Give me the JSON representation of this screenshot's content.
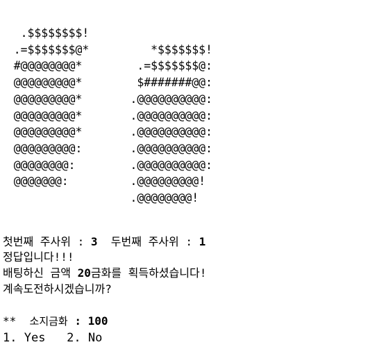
{
  "dice_art": "   .$$$$$$$$!\n  .=$$$$$$$@*         *$$$$$$$!\n  #@@@@@@@@*        .=$$$$$$$@:\n  @@@@@@@@@*        $#######@@:\n  @@@@@@@@@*       .@@@@@@@@@@:\n  @@@@@@@@@*       .@@@@@@@@@@:\n  @@@@@@@@@*       .@@@@@@@@@@:\n  @@@@@@@@@:       .@@@@@@@@@@:\n  @@@@@@@@:        .@@@@@@@@@@:\n  @@@@@@@:         .@@@@@@@@@!\n                   .@@@@@@@@!",
  "roll": {
    "first_label": "첫번째 주사위",
    "sep1": ":",
    "first_value": "3",
    "second_label": "두번째 주사위",
    "sep2": ":",
    "second_value": "1"
  },
  "result_text": "정답입니다!!!",
  "payout": {
    "prefix": "배팅하신 금액",
    "amount": "20",
    "suffix": "금화를 획득하셨습니다!"
  },
  "continue_prompt": "계속도전하시겠습니까?",
  "balance": {
    "stars": "**",
    "label": "소지금화",
    "sep": ":",
    "value": "100"
  },
  "options": [
    {
      "key": "1.",
      "label": "Yes"
    },
    {
      "key": "2.",
      "label": "No"
    }
  ]
}
